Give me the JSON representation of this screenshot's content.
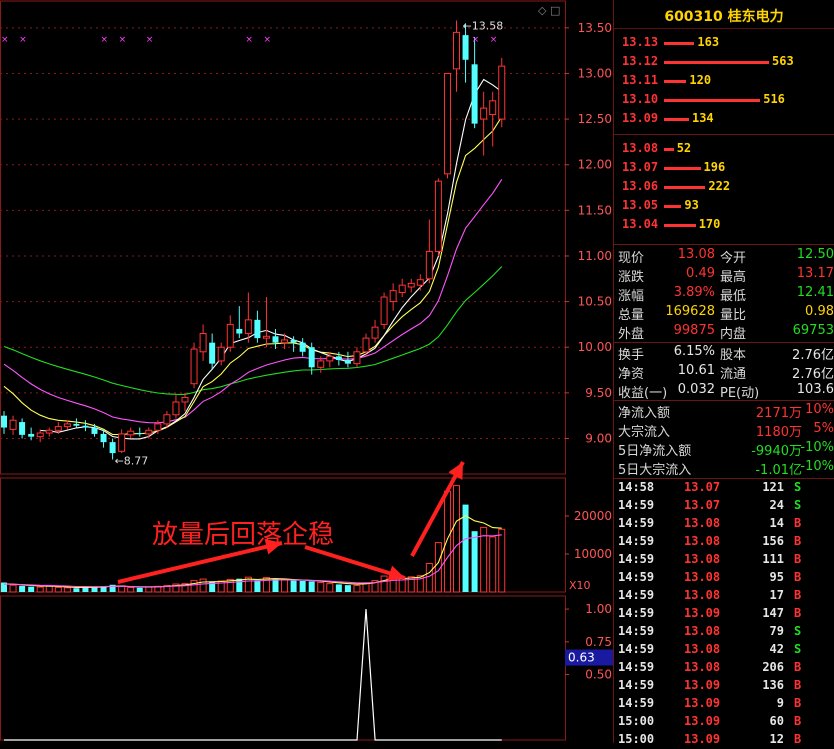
{
  "stock": {
    "code": "600310",
    "name": "桂东电力"
  },
  "annotation": "放量后回落企稳",
  "colors": {
    "up": "#ff3333",
    "down": "#54ffff",
    "ma5": "#ffffff",
    "ma10": "#ffff55",
    "ma20": "#ff55ff",
    "ma60": "#22dd22",
    "grid": "#8a1a1a"
  },
  "orderbook": {
    "asks": [
      {
        "price": "13.13",
        "vol": "163",
        "v": 163
      },
      {
        "price": "13.12",
        "vol": "563",
        "v": 563
      },
      {
        "price": "13.11",
        "vol": "120",
        "v": 120
      },
      {
        "price": "13.10",
        "vol": "516",
        "v": 516
      },
      {
        "price": "13.09",
        "vol": "134",
        "v": 134
      }
    ],
    "bids": [
      {
        "price": "13.08",
        "vol": "52",
        "v": 52
      },
      {
        "price": "13.07",
        "vol": "196",
        "v": 196
      },
      {
        "price": "13.06",
        "vol": "222",
        "v": 222
      },
      {
        "price": "13.05",
        "vol": "93",
        "v": 93
      },
      {
        "price": "13.04",
        "vol": "170",
        "v": 170
      }
    ]
  },
  "quote": {
    "rows1": [
      {
        "l1": "现价",
        "v1": "13.08",
        "c1": "red",
        "l2": "今开",
        "v2": "12.50",
        "c2": "green"
      },
      {
        "l1": "涨跌",
        "v1": "0.49",
        "c1": "red",
        "l2": "最高",
        "v2": "13.17",
        "c2": "red"
      },
      {
        "l1": "涨幅",
        "v1": "3.89%",
        "c1": "red",
        "l2": "最低",
        "v2": "12.41",
        "c2": "green"
      },
      {
        "l1": "总量",
        "v1": "169628",
        "c1": "yellow",
        "l2": "量比",
        "v2": "0.98",
        "c2": "yellow"
      },
      {
        "l1": "外盘",
        "v1": "99875",
        "c1": "red",
        "l2": "内盘",
        "v2": "69753",
        "c2": "green"
      }
    ],
    "rows2": [
      {
        "l1": "换手",
        "v1": "6.15%",
        "c1": "white",
        "l2": "股本",
        "v2": "2.76亿",
        "c2": "white"
      },
      {
        "l1": "净资",
        "v1": "10.61",
        "c1": "white",
        "l2": "流通",
        "v2": "2.76亿",
        "c2": "white"
      },
      {
        "l1": "收益(一)",
        "v1": "0.032",
        "c1": "white",
        "l2": "PE(动)",
        "v2": "103.6",
        "c2": "white"
      }
    ],
    "flows": [
      {
        "l": "净流入额",
        "v": "2171万",
        "c": "red",
        "p": "10%",
        "pc": "red"
      },
      {
        "l": "大宗流入",
        "v": "1180万",
        "c": "red",
        "p": "5%",
        "pc": "red"
      },
      {
        "l": "5日净流入额",
        "v": "-9940万",
        "c": "green",
        "p": "-10%",
        "pc": "green"
      },
      {
        "l": "5日大宗流入",
        "v": "-1.01亿",
        "c": "green",
        "p": "-10%",
        "pc": "green"
      }
    ]
  },
  "ticks": [
    {
      "t": "14:58",
      "p": "13.07",
      "v": "121",
      "s": "S"
    },
    {
      "t": "14:59",
      "p": "13.07",
      "v": "24",
      "s": "S"
    },
    {
      "t": "14:59",
      "p": "13.08",
      "v": "14",
      "s": "B"
    },
    {
      "t": "14:59",
      "p": "13.08",
      "v": "156",
      "s": "B"
    },
    {
      "t": "14:59",
      "p": "13.08",
      "v": "111",
      "s": "B"
    },
    {
      "t": "14:59",
      "p": "13.08",
      "v": "95",
      "s": "B"
    },
    {
      "t": "14:59",
      "p": "13.08",
      "v": "17",
      "s": "B"
    },
    {
      "t": "14:59",
      "p": "13.09",
      "v": "147",
      "s": "B"
    },
    {
      "t": "14:59",
      "p": "13.08",
      "v": "79",
      "s": "S"
    },
    {
      "t": "14:59",
      "p": "13.08",
      "v": "42",
      "s": "S"
    },
    {
      "t": "14:59",
      "p": "13.08",
      "v": "206",
      "s": "B"
    },
    {
      "t": "14:59",
      "p": "13.09",
      "v": "136",
      "s": "B"
    },
    {
      "t": "14:59",
      "p": "13.09",
      "v": "9",
      "s": "B"
    },
    {
      "t": "15:00",
      "p": "13.09",
      "v": "60",
      "s": "B"
    },
    {
      "t": "15:00",
      "p": "13.09",
      "v": "12",
      "s": "B"
    }
  ],
  "chart_data": {
    "type": "candlestick",
    "price_axis": {
      "ylim": [
        8.6,
        13.75
      ],
      "ticks": [
        "13.50",
        "13.00",
        "12.50",
        "12.00",
        "11.50",
        "11.00",
        "10.50",
        "10.00",
        "9.50",
        "9.00"
      ]
    },
    "annotations": {
      "high": "13.58",
      "low": "8.77"
    },
    "candles": [
      {
        "o": 9.25,
        "h": 9.3,
        "l": 9.05,
        "c": 9.12
      },
      {
        "o": 9.1,
        "h": 9.25,
        "l": 9.04,
        "c": 9.2
      },
      {
        "o": 9.18,
        "h": 9.22,
        "l": 9.0,
        "c": 9.04
      },
      {
        "o": 9.05,
        "h": 9.12,
        "l": 8.98,
        "c": 9.02
      },
      {
        "o": 9.02,
        "h": 9.1,
        "l": 8.96,
        "c": 9.06
      },
      {
        "o": 9.06,
        "h": 9.12,
        "l": 9.02,
        "c": 9.09
      },
      {
        "o": 9.09,
        "h": 9.18,
        "l": 9.05,
        "c": 9.13
      },
      {
        "o": 9.13,
        "h": 9.2,
        "l": 9.1,
        "c": 9.16
      },
      {
        "o": 9.16,
        "h": 9.22,
        "l": 9.12,
        "c": 9.14
      },
      {
        "o": 9.14,
        "h": 9.2,
        "l": 9.08,
        "c": 9.12
      },
      {
        "o": 9.12,
        "h": 9.16,
        "l": 9.02,
        "c": 9.05
      },
      {
        "o": 9.05,
        "h": 9.1,
        "l": 8.9,
        "c": 8.96
      },
      {
        "o": 8.96,
        "h": 9.0,
        "l": 8.77,
        "c": 8.84
      },
      {
        "o": 8.86,
        "h": 9.1,
        "l": 8.84,
        "c": 9.05
      },
      {
        "o": 9.04,
        "h": 9.12,
        "l": 9.0,
        "c": 9.08
      },
      {
        "o": 9.06,
        "h": 9.12,
        "l": 9.02,
        "c": 9.05
      },
      {
        "o": 9.05,
        "h": 9.12,
        "l": 9.0,
        "c": 9.09
      },
      {
        "o": 9.09,
        "h": 9.2,
        "l": 9.05,
        "c": 9.16
      },
      {
        "o": 9.16,
        "h": 9.3,
        "l": 9.12,
        "c": 9.26
      },
      {
        "o": 9.26,
        "h": 9.48,
        "l": 9.22,
        "c": 9.4
      },
      {
        "o": 9.4,
        "h": 9.5,
        "l": 9.3,
        "c": 9.45
      },
      {
        "o": 9.6,
        "h": 10.05,
        "l": 9.55,
        "c": 9.98
      },
      {
        "o": 9.95,
        "h": 10.25,
        "l": 9.85,
        "c": 10.15
      },
      {
        "o": 10.05,
        "h": 10.15,
        "l": 9.75,
        "c": 9.82
      },
      {
        "o": 9.85,
        "h": 10.05,
        "l": 9.8,
        "c": 10.0
      },
      {
        "o": 10.0,
        "h": 10.35,
        "l": 9.95,
        "c": 10.25
      },
      {
        "o": 10.2,
        "h": 10.45,
        "l": 10.1,
        "c": 10.15
      },
      {
        "o": 10.15,
        "h": 10.6,
        "l": 10.05,
        "c": 10.3
      },
      {
        "o": 10.3,
        "h": 10.4,
        "l": 10.05,
        "c": 10.1
      },
      {
        "o": 10.1,
        "h": 10.55,
        "l": 10.0,
        "c": 10.12
      },
      {
        "o": 10.12,
        "h": 10.2,
        "l": 9.98,
        "c": 10.05
      },
      {
        "o": 10.05,
        "h": 10.15,
        "l": 9.98,
        "c": 10.08
      },
      {
        "o": 10.08,
        "h": 10.12,
        "l": 9.95,
        "c": 10.05
      },
      {
        "o": 10.05,
        "h": 10.1,
        "l": 9.9,
        "c": 9.95
      },
      {
        "o": 10.0,
        "h": 10.05,
        "l": 9.7,
        "c": 9.78
      },
      {
        "o": 9.78,
        "h": 9.9,
        "l": 9.72,
        "c": 9.85
      },
      {
        "o": 9.85,
        "h": 9.95,
        "l": 9.78,
        "c": 9.9
      },
      {
        "o": 9.9,
        "h": 9.95,
        "l": 9.8,
        "c": 9.86
      },
      {
        "o": 9.86,
        "h": 9.95,
        "l": 9.78,
        "c": 9.82
      },
      {
        "o": 9.82,
        "h": 10.0,
        "l": 9.78,
        "c": 9.95
      },
      {
        "o": 9.95,
        "h": 10.15,
        "l": 9.9,
        "c": 10.1
      },
      {
        "o": 10.1,
        "h": 10.3,
        "l": 10.05,
        "c": 10.22
      },
      {
        "o": 10.25,
        "h": 10.6,
        "l": 10.2,
        "c": 10.55
      },
      {
        "o": 10.5,
        "h": 10.7,
        "l": 10.4,
        "c": 10.62
      },
      {
        "o": 10.6,
        "h": 10.75,
        "l": 10.55,
        "c": 10.68
      },
      {
        "o": 10.66,
        "h": 10.75,
        "l": 10.6,
        "c": 10.7
      },
      {
        "o": 10.68,
        "h": 10.8,
        "l": 10.62,
        "c": 10.74
      },
      {
        "o": 10.75,
        "h": 11.4,
        "l": 10.7,
        "c": 11.05
      },
      {
        "o": 11.05,
        "h": 11.85,
        "l": 11.0,
        "c": 11.82
      },
      {
        "o": 11.9,
        "h": 13.0,
        "l": 11.85,
        "c": 13.0
      },
      {
        "o": 13.05,
        "h": 13.58,
        "l": 12.8,
        "c": 13.45
      },
      {
        "o": 13.42,
        "h": 13.55,
        "l": 12.9,
        "c": 13.15
      },
      {
        "o": 13.1,
        "h": 13.4,
        "l": 12.4,
        "c": 12.45
      },
      {
        "o": 12.5,
        "h": 12.8,
        "l": 12.1,
        "c": 12.62
      },
      {
        "o": 12.55,
        "h": 12.8,
        "l": 12.2,
        "c": 12.7
      },
      {
        "o": 12.5,
        "h": 13.17,
        "l": 12.41,
        "c": 13.08
      }
    ],
    "volume": {
      "ylim": [
        0,
        30000
      ],
      "ticks": [
        "20000",
        "10000"
      ],
      "unit_label": "X10",
      "values": [
        2500,
        1800,
        1600,
        1400,
        1300,
        1500,
        1200,
        1100,
        1000,
        1200,
        1300,
        1500,
        1900,
        1600,
        1200,
        1100,
        1300,
        1500,
        1700,
        2100,
        2200,
        3000,
        3400,
        2800,
        2900,
        3300,
        3500,
        3900,
        3100,
        3800,
        3600,
        3300,
        3000,
        2900,
        2800,
        2500,
        2200,
        2000,
        1800,
        1700,
        2400,
        3000,
        4200,
        4500,
        3600,
        4000,
        4300,
        7500,
        13000,
        26500,
        28000,
        23000,
        16000,
        17000,
        14500,
        16500
      ]
    },
    "indicator": {
      "ylim": [
        0,
        1.1
      ],
      "ticks": [
        "1.00",
        "0.75",
        "0.50"
      ],
      "current": "0.63",
      "spike_index": 40
    }
  }
}
